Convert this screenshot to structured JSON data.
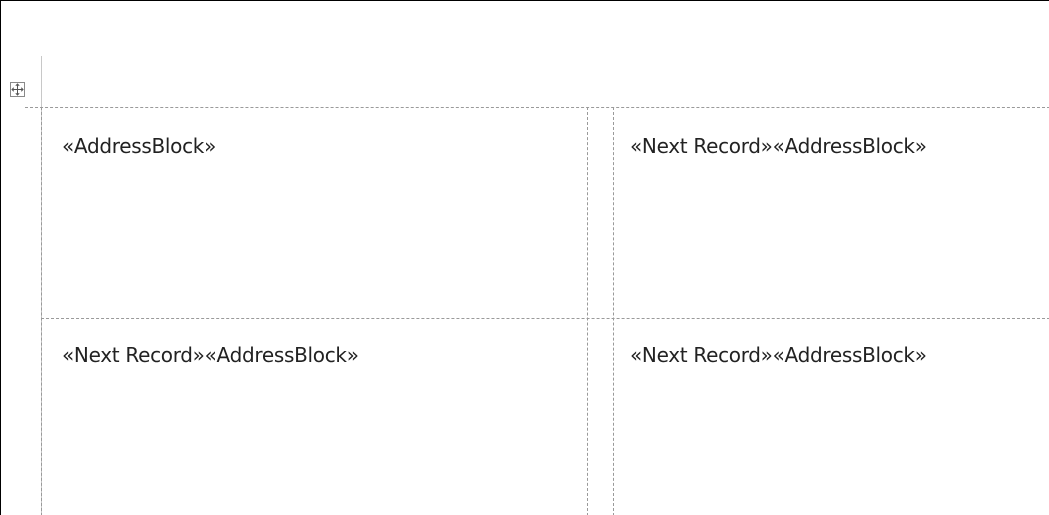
{
  "document": {
    "table_move_handle": "move-arrows-icon",
    "labels": [
      {
        "row": 1,
        "column": 1,
        "text": "«AddressBlock»"
      },
      {
        "row": 1,
        "column": 2,
        "text": "«Next Record»«AddressBlock»"
      },
      {
        "row": 2,
        "column": 1,
        "text": "«Next Record»«AddressBlock»"
      },
      {
        "row": 2,
        "column": 2,
        "text": "«Next Record»«AddressBlock»"
      }
    ]
  }
}
